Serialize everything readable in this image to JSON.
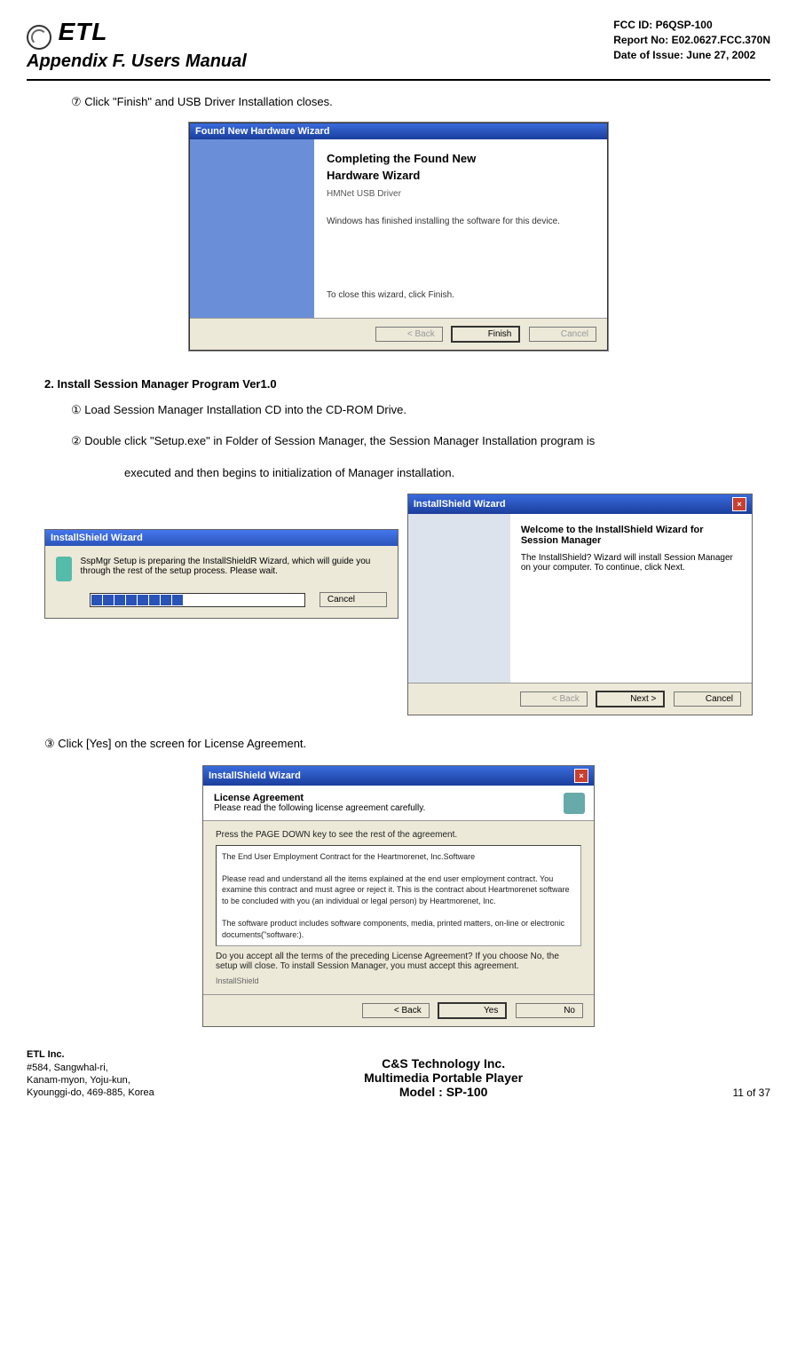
{
  "header": {
    "logo_text": "ETL",
    "appendix_title": "Appendix F.  Users Manual",
    "fcc_id": "FCC ID: P6QSP-100",
    "report_no": "Report No: E02.0627.FCC.370N",
    "date_of_issue": "Date of Issue: June 27, 2002"
  },
  "steps": {
    "step7": "⑦ Click \"Finish\" and USB Driver Installation closes."
  },
  "wizard1": {
    "titlebar": "Found New Hardware Wizard",
    "title_line1": "Completing the Found New",
    "title_line2": "Hardware Wizard",
    "driver_name": "HMNet USB Driver",
    "body_text": "Windows has finished installing the software for this device.",
    "close_text": "To close this wizard, click Finish.",
    "btn_back": "< Back",
    "btn_finish": "Finish",
    "btn_cancel": "Cancel"
  },
  "section2": {
    "heading": "2. Install Session Manager Program Ver1.0",
    "step1": "① Load Session Manager Installation CD into the CD-ROM Drive.",
    "step2": "② Double click \"Setup.exe\" in Folder of Session Manager, the Session Manager Installation program is",
    "step2b": "executed and then begins to initialization of Manager installation.",
    "step3": "③ Click [Yes] on the screen for License Agreement."
  },
  "prep_dialog": {
    "titlebar": "InstallShield Wizard",
    "text": "SspMgr Setup is preparing the InstallShieldR Wizard, which will guide you through the rest of the setup process. Please wait.",
    "btn_cancel": "Cancel"
  },
  "welcome_dialog": {
    "titlebar": "InstallShield Wizard",
    "title": "Welcome to the InstallShield Wizard for Session Manager",
    "body": "The InstallShield? Wizard will install Session Manager on your computer. To continue, click Next.",
    "btn_back": "< Back",
    "btn_next": "Next >",
    "btn_cancel": "Cancel"
  },
  "license_dialog": {
    "titlebar": "InstallShield Wizard",
    "header_title": "License Agreement",
    "header_sub": "Please read the following license agreement carefully.",
    "instruction": "Press the PAGE DOWN key to see the rest of the agreement.",
    "box_line1": "The End User Employment Contract  for the Heartmorenet, Inc.Software",
    "box_line2": "Please read and understand all the items explained at the end user employment contract. You examine this contract and must agree or reject it. This is the contract about Heartmorenet software to be concluded with you (an individual or legal person) by Heartmorenet, Inc.",
    "box_line3": "  The software product includes software components, media, printed matters, on-line or electronic documents(\"software:).",
    "accept_text": "Do you accept all the terms of the preceding License Agreement? If you choose No, the setup will close. To install Session Manager, you must accept this agreement.",
    "shield_label": "InstallShield",
    "btn_back": "< Back",
    "btn_yes": "Yes",
    "btn_no": "No"
  },
  "footer": {
    "company": "ETL Inc.",
    "addr1": "#584, Sangwhal-ri,",
    "addr2": "Kanam-myon, Yoju-kun,",
    "addr3": "Kyounggi-do, 469-885, Korea",
    "center1": "C&S Technology Inc.",
    "center2": "Multimedia Portable Player",
    "center3": "Model : SP-100",
    "page": "11 of 37"
  }
}
